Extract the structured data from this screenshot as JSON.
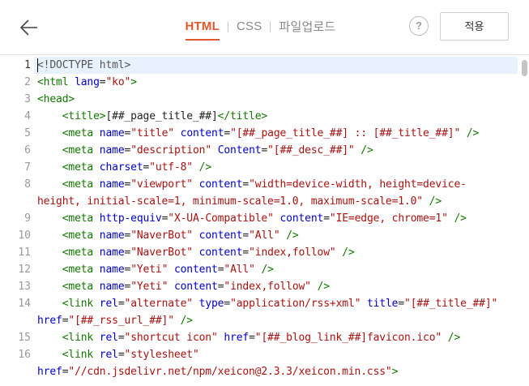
{
  "header": {
    "tabs": [
      {
        "label": "HTML"
      },
      {
        "label": "CSS"
      },
      {
        "label": "파일업로드"
      }
    ],
    "help_label": "?",
    "apply_label": "적용"
  },
  "editor": {
    "line_numbers": [
      "1",
      "2",
      "3",
      "4",
      "5",
      "6",
      "7",
      "8",
      "9",
      "10",
      "11",
      "12",
      "13",
      "14",
      "15",
      "16"
    ],
    "lines": [
      "1: <!DOCTYPE html>",
      "2: <html lang=\"ko\">",
      "3: <head>",
      "4:     <title>[##_page_title_##]</title>",
      "5:     <meta name=\"title\" content=\"[##_page_title_##] :: [##_title_##]\" />",
      "6:     <meta name=\"description\" Content=\"[##_desc_##]\" />",
      "7:     <meta charset=\"utf-8\" />",
      "8:     <meta name=\"viewport\" content=\"width=device-width, height=device-height, initial-scale=1, minimum-scale=1.0, maximum-scale=1.0\" />",
      "9:     <meta http-equiv=\"X-UA-Compatible\" content=\"IE=edge, chrome=1\" />",
      "10:     <meta name=\"NaverBot\" content=\"All\" />",
      "11:     <meta name=\"NaverBot\" content=\"index,follow\" />",
      "12:     <meta name=\"Yeti\" content=\"All\" />",
      "13:     <meta name=\"Yeti\" content=\"index,follow\" />",
      "14:     <link rel=\"alternate\" type=\"application/rss+xml\" title=\"[##_title_##]\" href=\"[##_rss_url_##]\" />",
      "15:     <link rel=\"shortcut icon\" href=\"[##_blog_link_##]favicon.ico\" />",
      "16:     <link rel=\"stylesheet\" href=\"//cdn.jsdelivr.net/npm/xeicon@2.3.3/xeicon.min.css\">"
    ]
  }
}
